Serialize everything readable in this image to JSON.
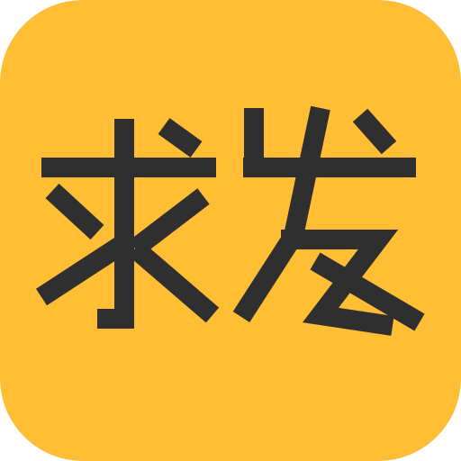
{
  "app_icon": {
    "logo_text": "求发",
    "background_color": "#FFBE33",
    "glyph_color": "#2F2F2F"
  }
}
